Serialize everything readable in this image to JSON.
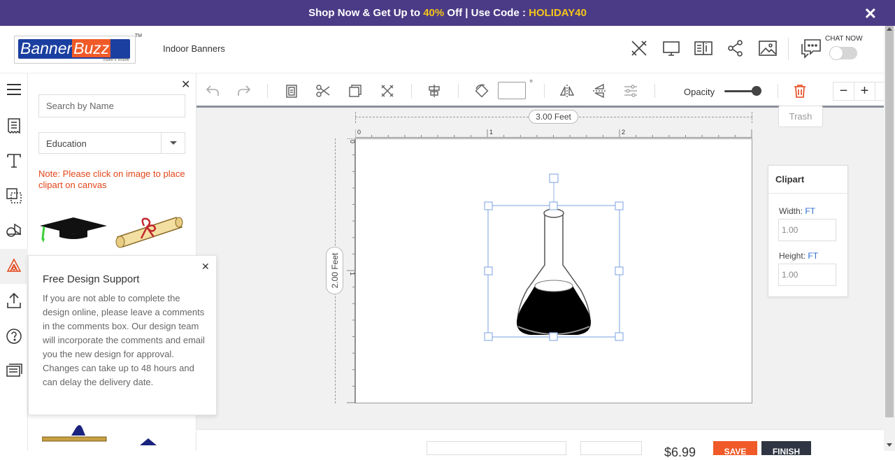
{
  "promo": {
    "text_before": "Shop Now & Get Up to ",
    "highlight_percent": "40%",
    "text_middle": " Off | Use Code : ",
    "code": "HOLIDAY40",
    "close_icon": "close-icon"
  },
  "header": {
    "logo_text_banner": "Banner",
    "logo_text_buzz": "Buzz",
    "logo_tagline": "make it visible",
    "logo_tm": "TM",
    "page_title": "Indoor Banners",
    "icons": [
      "design-tools-icon",
      "desktop-preview-icon",
      "spec-sheet-icon",
      "share-icon",
      "image-icon"
    ],
    "chat_label": "CHAT NOW",
    "chat_icon": "chat-icon",
    "chat_toggle_on": false
  },
  "left_nav": {
    "icons": [
      "menu-icon",
      "template-icon",
      "text-icon",
      "shapes-icon",
      "clipart-icon",
      "background-icon",
      "upload-icon",
      "help-icon",
      "notes-icon"
    ],
    "active_index": 5
  },
  "clipart_panel": {
    "search_placeholder": "Search by Name",
    "category": "Education",
    "note": "Note: Please click on image to place clipart on canvas",
    "items": [
      "graduation-cap-clipart",
      "diploma-scroll-clipart"
    ]
  },
  "support_popup": {
    "title": "Free Design Support",
    "body": "If you are not able to complete the design online, please leave a comments in the comments box. Our design team will incorporate the comments and email you the new design for approval. Changes can take up to 48 hours and can delay the delivery date."
  },
  "toolbar": {
    "icons": [
      "undo-icon",
      "redo-icon",
      "paste-icon",
      "cut-icon",
      "copy-icon",
      "delete-x-icon",
      "align-center-icon",
      "rotate-icon",
      "flip-horizontal-icon",
      "flip-vertical-icon",
      "adjust-icon"
    ],
    "rotation_value": "",
    "degree_symbol": "°",
    "opacity_label": "Opacity",
    "opacity_value": 1.0,
    "trash_tooltip": "Trash",
    "zoom_out": "−",
    "zoom_in": "+"
  },
  "canvas": {
    "width_label": "3.00 Feet",
    "height_label": "2.00 Feet",
    "ruler_h_labels": [
      "0",
      "1",
      "2"
    ],
    "ruler_v_labels": [
      "0",
      "1"
    ],
    "selected_object": "erlenmeyer-flask-clipart"
  },
  "properties_panel": {
    "title": "Clipart",
    "width_label": "Width: ",
    "width_unit": "FT",
    "width_value": "1.00",
    "height_label": "Height: ",
    "height_unit": "FT",
    "height_value": "1.00"
  },
  "bottom_bar": {
    "price": "$6.99",
    "save_label": "SAVE",
    "finish_label": "FINISH"
  }
}
